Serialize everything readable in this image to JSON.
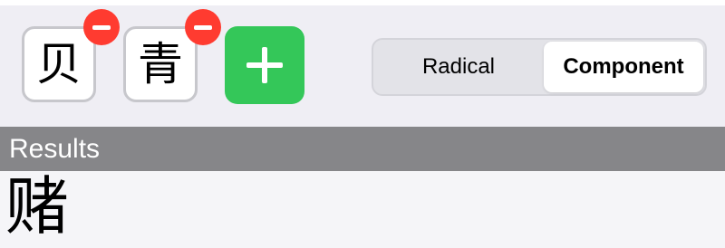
{
  "selected_components": [
    {
      "char": "贝",
      "remove_icon": "minus-circle-icon"
    },
    {
      "char": "青",
      "remove_icon": "minus-circle-icon"
    }
  ],
  "add_button": {
    "icon": "plus-icon"
  },
  "segmented_control": {
    "options": [
      "Radical",
      "Component"
    ],
    "selected": "Component"
  },
  "results": {
    "header": "Results",
    "items": [
      "赌"
    ]
  },
  "colors": {
    "background": "#efeef4",
    "remove_badge": "#ff3b30",
    "add_button": "#34c759",
    "section_header": "#868689",
    "chip_border": "#c7c7cc"
  }
}
